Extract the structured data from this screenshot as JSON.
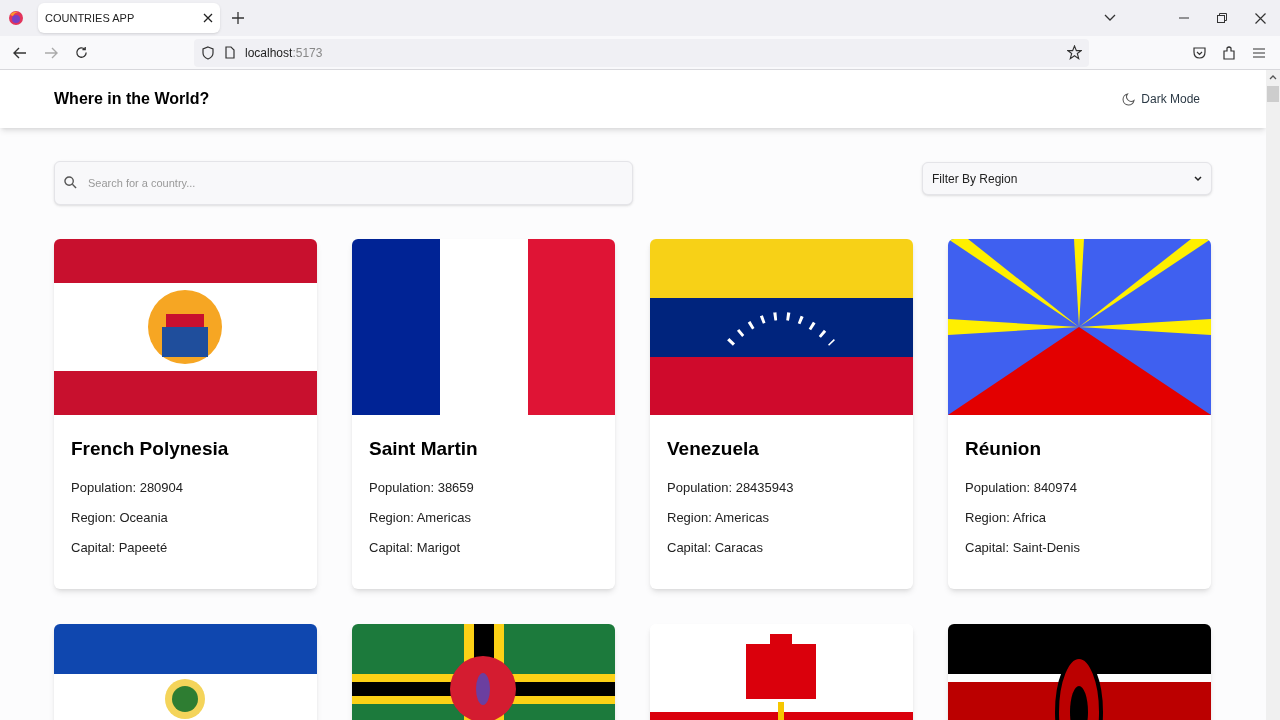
{
  "browser": {
    "tab_title": "COUNTRIES APP",
    "url_host": "localhost",
    "url_port": ":5173"
  },
  "header": {
    "title": "Where in the World?",
    "mode_toggle": "Dark Mode"
  },
  "search": {
    "placeholder": "Search for a country..."
  },
  "filter": {
    "value": "Filter By Region"
  },
  "cards": [
    {
      "flag": {
        "kind": "picture"
      },
      "name": "French Polynesia",
      "population": "Population: 280904",
      "region": "Region: Oceania",
      "capital": "Capital: Papeeté"
    },
    {
      "flag": {
        "kind": "picture"
      },
      "name": "Saint Martin",
      "population": "Population: 38659",
      "region": "Region: Americas",
      "capital": "Capital: Marigot"
    },
    {
      "flag": {
        "kind": "picture"
      },
      "name": "Venezuela",
      "population": "Population: 28435943",
      "region": "Region: Americas",
      "capital": "Capital: Caracas"
    },
    {
      "flag": {
        "kind": "picture"
      },
      "name": "Réunion",
      "population": "Population: 840974",
      "region": "Region: Africa",
      "capital": "Capital: Saint-Denis"
    },
    {
      "flag": {
        "kind": "picture"
      }
    },
    {
      "flag": {
        "kind": "picture"
      }
    },
    {
      "flag": {
        "kind": "picture"
      }
    },
    {
      "flag": {
        "kind": "picture"
      }
    }
  ]
}
